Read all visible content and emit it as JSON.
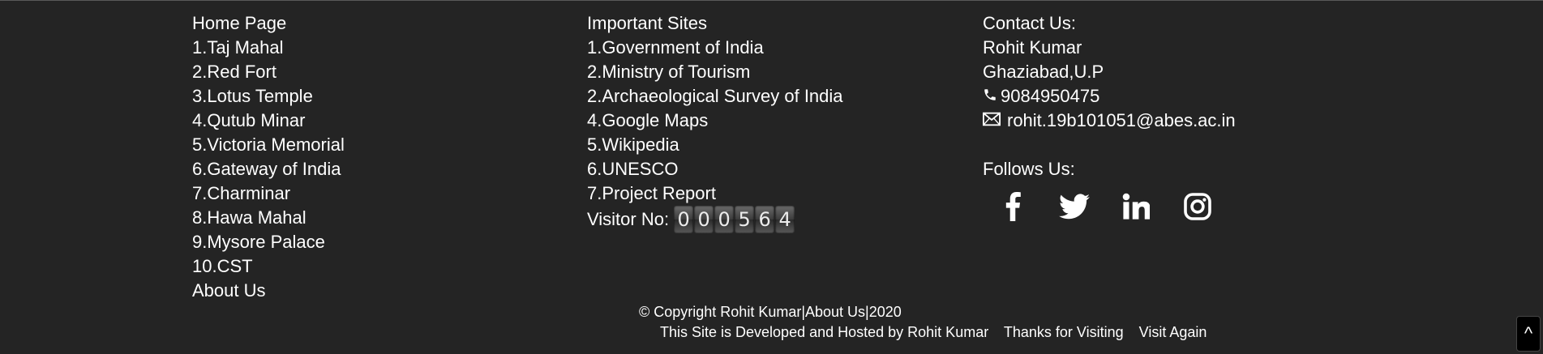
{
  "col1": {
    "heading": "Home Page",
    "items": [
      "1.Taj Mahal",
      "2.Red Fort",
      "3.Lotus Temple",
      "4.Qutub Minar",
      "5.Victoria Memorial",
      "6.Gateway of India",
      "7.Charminar",
      "8.Hawa Mahal",
      "9.Mysore Palace",
      "10.CST"
    ],
    "about": "About Us"
  },
  "col2": {
    "heading": "Important Sites",
    "items": [
      "1.Government of India",
      "2.Ministry of Tourism",
      "2.Archaeological Survey of India",
      "4.Google Maps",
      "5.Wikipedia",
      "6.UNESCO",
      "7.Project Report"
    ],
    "visitor_label": "Visitor No:",
    "visitor_digits": [
      "0",
      "0",
      "0",
      "5",
      "6",
      "4"
    ]
  },
  "col3": {
    "heading": "Contact Us:",
    "name": "Rohit Kumar",
    "location": "Ghaziabad,U.P",
    "phone_icon": "phone-icon",
    "phone": "9084950475",
    "email_icon": "envelope-icon",
    "email": "rohit.19b101051@abes.ac.in",
    "follow_heading": "Follows Us:",
    "social_icons": [
      "facebook-icon",
      "twitter-icon",
      "linkedin-icon",
      "instagram-icon"
    ]
  },
  "footer": {
    "copyright": "© Copyright Rohit Kumar|About Us|2020",
    "developed": "This Site is Developed and Hosted by Rohit Kumar",
    "thanks": "Thanks for Visiting",
    "again": "Visit Again"
  },
  "scroll_top": {
    "label": "^"
  },
  "colors": {
    "background": "#242424",
    "text": "#ffffff"
  }
}
